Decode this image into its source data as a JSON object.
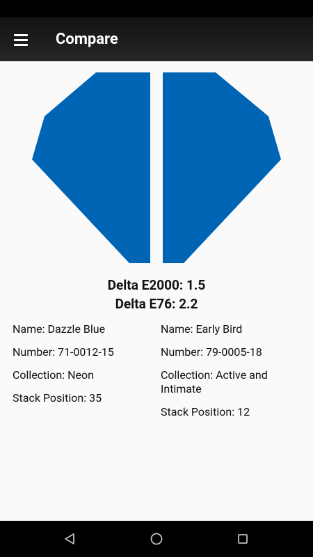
{
  "app": {
    "title": "Compare"
  },
  "colors": {
    "left_swatch": "#0064b4",
    "right_swatch": "#0064b4"
  },
  "delta": {
    "e2000": "Delta E2000: 1.5",
    "e76": "Delta E76: 2.2"
  },
  "left": {
    "name": "Name: Dazzle Blue",
    "number": "Number: 71-0012-15",
    "collection": "Collection: Neon",
    "stack": "Stack Position: 35"
  },
  "right": {
    "name": "Name: Early Bird",
    "number": "Number: 79-0005-18",
    "collection": "Collection: Active and Intimate",
    "stack": "Stack Position: 12"
  },
  "nav": {
    "back": "back-icon",
    "home": "home-icon",
    "recents": "recents-icon"
  }
}
